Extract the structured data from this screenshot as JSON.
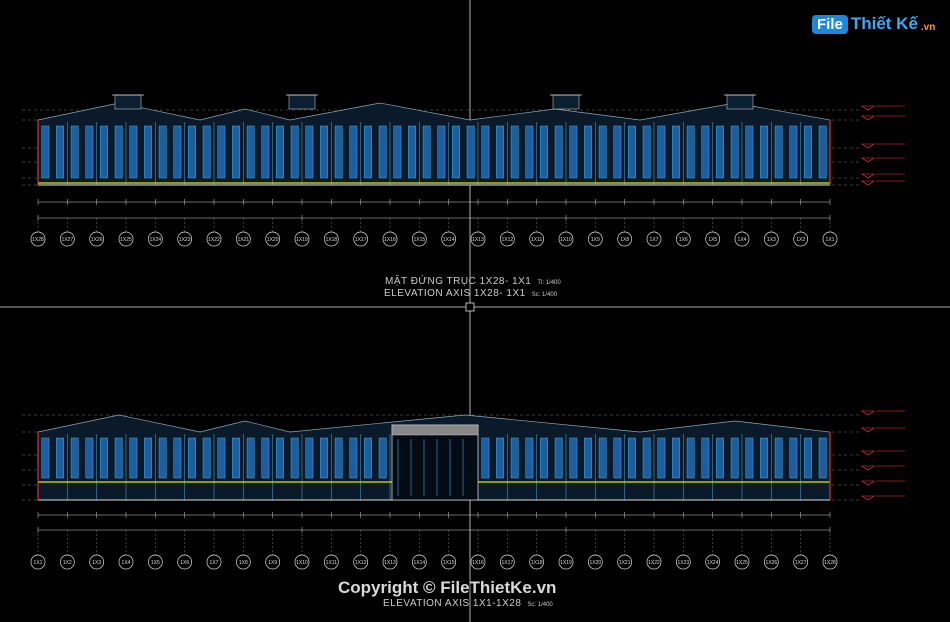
{
  "logo": {
    "file": "File",
    "brand": "Thiết Kế",
    "tld": ".vn"
  },
  "elevation_top": {
    "title_vi": "MẶT ĐỨNG TRỤC 1X28- 1X1",
    "scale_vi": "Tl: 1/400",
    "title_en": "ELEVATION AXIS 1X28- 1X1",
    "scale_en": "Sc: 1/400",
    "axes": [
      "1X28",
      "1X27",
      "1X26",
      "1X25",
      "1X24",
      "1X23",
      "1X22",
      "1X21",
      "1X20",
      "1X19",
      "1X18",
      "1X17",
      "1X16",
      "1X15",
      "1X14",
      "1X13",
      "1X12",
      "1X11",
      "1X10",
      "1X9",
      "1X8",
      "1X7",
      "1X6",
      "1X5",
      "1X4",
      "1X3",
      "1X2",
      "1X1"
    ]
  },
  "elevation_bottom": {
    "title_en": "ELEVATION AXIS 1X1-1X28",
    "scale_en": "Sc: 1/400",
    "axes": [
      "1X1",
      "1X2",
      "1X3",
      "1X4",
      "1X5",
      "1X6",
      "1X7",
      "1X8",
      "1X9",
      "1X10",
      "1X11",
      "1X12",
      "1X13",
      "1X14",
      "1X15",
      "1X16",
      "1X17",
      "1X18",
      "1X19",
      "1X20",
      "1X21",
      "1X22",
      "1X23",
      "1X24",
      "1X25",
      "1X26",
      "1X27",
      "1X28"
    ]
  },
  "copyright": "Copyright © FileThietKe.vn",
  "colors": {
    "background": "#000000",
    "glazing": "#1b5fa0",
    "frame": "#4fc3f7",
    "dimension": "#cfcfcf",
    "level_marker": "#ff3b3b",
    "yellow_line": "#e6e600",
    "crosshair": "#e0e0e0"
  }
}
